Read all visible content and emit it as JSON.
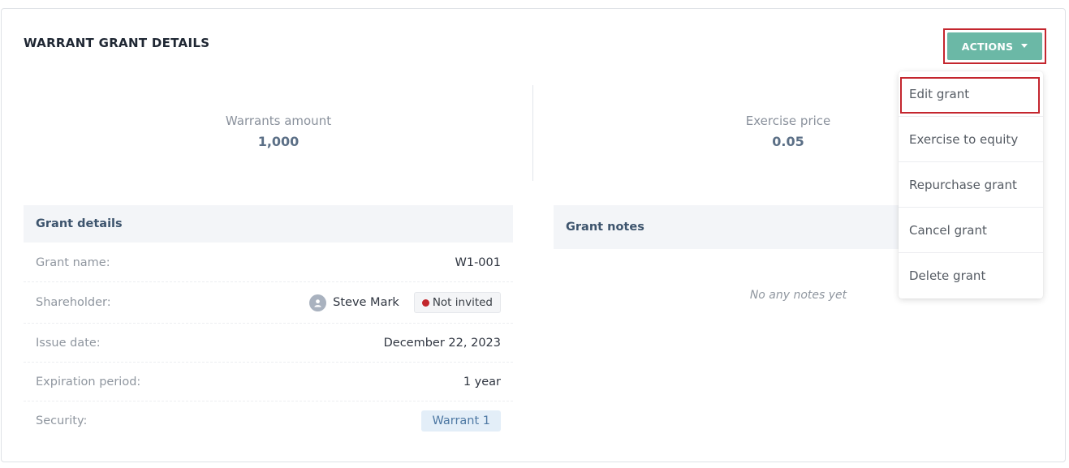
{
  "header": {
    "title": "WARRANT GRANT DETAILS",
    "actions_label": "ACTIONS"
  },
  "stats": {
    "warrants_label": "Warrants amount",
    "warrants_value": "1,000",
    "price_label": "Exercise price",
    "price_value": "0.05"
  },
  "details": {
    "heading": "Grant details",
    "rows": {
      "grant_name": {
        "label": "Grant name:",
        "value": "W1-001"
      },
      "shareholder": {
        "label": "Shareholder:",
        "name": "Steve Mark",
        "status": "Not invited"
      },
      "issue_date": {
        "label": "Issue date:",
        "value": "December 22, 2023"
      },
      "expiration": {
        "label": "Expiration period:",
        "value": "1 year"
      },
      "security": {
        "label": "Security:",
        "value": "Warrant 1"
      }
    }
  },
  "notes": {
    "heading": "Grant notes",
    "empty": "No any notes yet"
  },
  "menu": {
    "items": [
      "Edit grant",
      "Exercise to equity",
      "Repurchase grant",
      "Cancel grant",
      "Delete grant"
    ]
  },
  "colors": {
    "accent": "#6bb8a6",
    "highlight": "#c4262e",
    "status_red": "#c2262c"
  },
  "icons": {
    "avatar": "person-icon",
    "actions": "caret-down-icon"
  }
}
